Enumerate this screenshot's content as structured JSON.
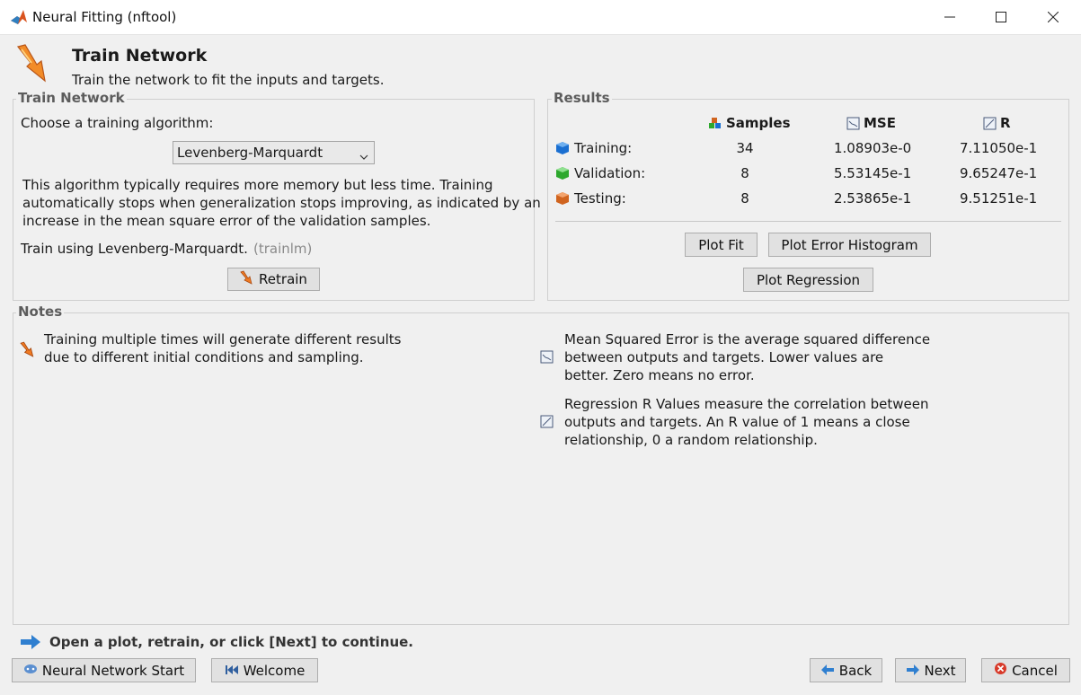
{
  "window": {
    "title": "Neural Fitting (nftool)"
  },
  "header": {
    "title": "Train Network",
    "subtitle": "Train the network to fit the inputs and targets."
  },
  "train_panel": {
    "legend": "Train Network",
    "choose_label": "Choose a training algorithm:",
    "algorithm_selected": "Levenberg-Marquardt",
    "description_lines": [
      "This algorithm typically requires more memory but less time. Training",
      "automatically stops when generalization stops improving, as indicated by an",
      "increase in the mean square error of the validation samples."
    ],
    "train_using": "Train using Levenberg-Marquardt.",
    "train_fn": "(trainlm)",
    "retrain_label": "Retrain"
  },
  "results": {
    "legend": "Results",
    "columns": [
      "Samples",
      "MSE",
      "R"
    ],
    "rows": [
      {
        "label": "Training:",
        "samples": "34",
        "mse": "1.08903e-0",
        "r": "7.11050e-1",
        "color": "#1a6fd1"
      },
      {
        "label": "Validation:",
        "samples": "8",
        "mse": "5.53145e-1",
        "r": "9.65247e-1",
        "color": "#2ea82e"
      },
      {
        "label": "Testing:",
        "samples": "8",
        "mse": "2.53865e-1",
        "r": "9.51251e-1",
        "color": "#d0641f"
      }
    ],
    "plot_fit": "Plot Fit",
    "plot_error_histogram": "Plot Error Histogram",
    "plot_regression": "Plot Regression"
  },
  "notes": {
    "legend": "Notes",
    "left_lines": [
      "Training multiple times will generate different results",
      "due to different initial conditions and sampling."
    ],
    "mse_lines": [
      "Mean Squared Error is the average squared difference",
      "between outputs and targets. Lower values are",
      "better. Zero means no error."
    ],
    "r_lines": [
      "Regression R Values measure the correlation between",
      "outputs and targets. An R value of 1 means a close",
      "relationship, 0 a random relationship."
    ]
  },
  "footer": {
    "hint": "Open a plot, retrain, or click [Next] to continue.",
    "start": "Neural Network Start",
    "welcome": "Welcome",
    "back": "Back",
    "next": "Next",
    "cancel": "Cancel"
  }
}
